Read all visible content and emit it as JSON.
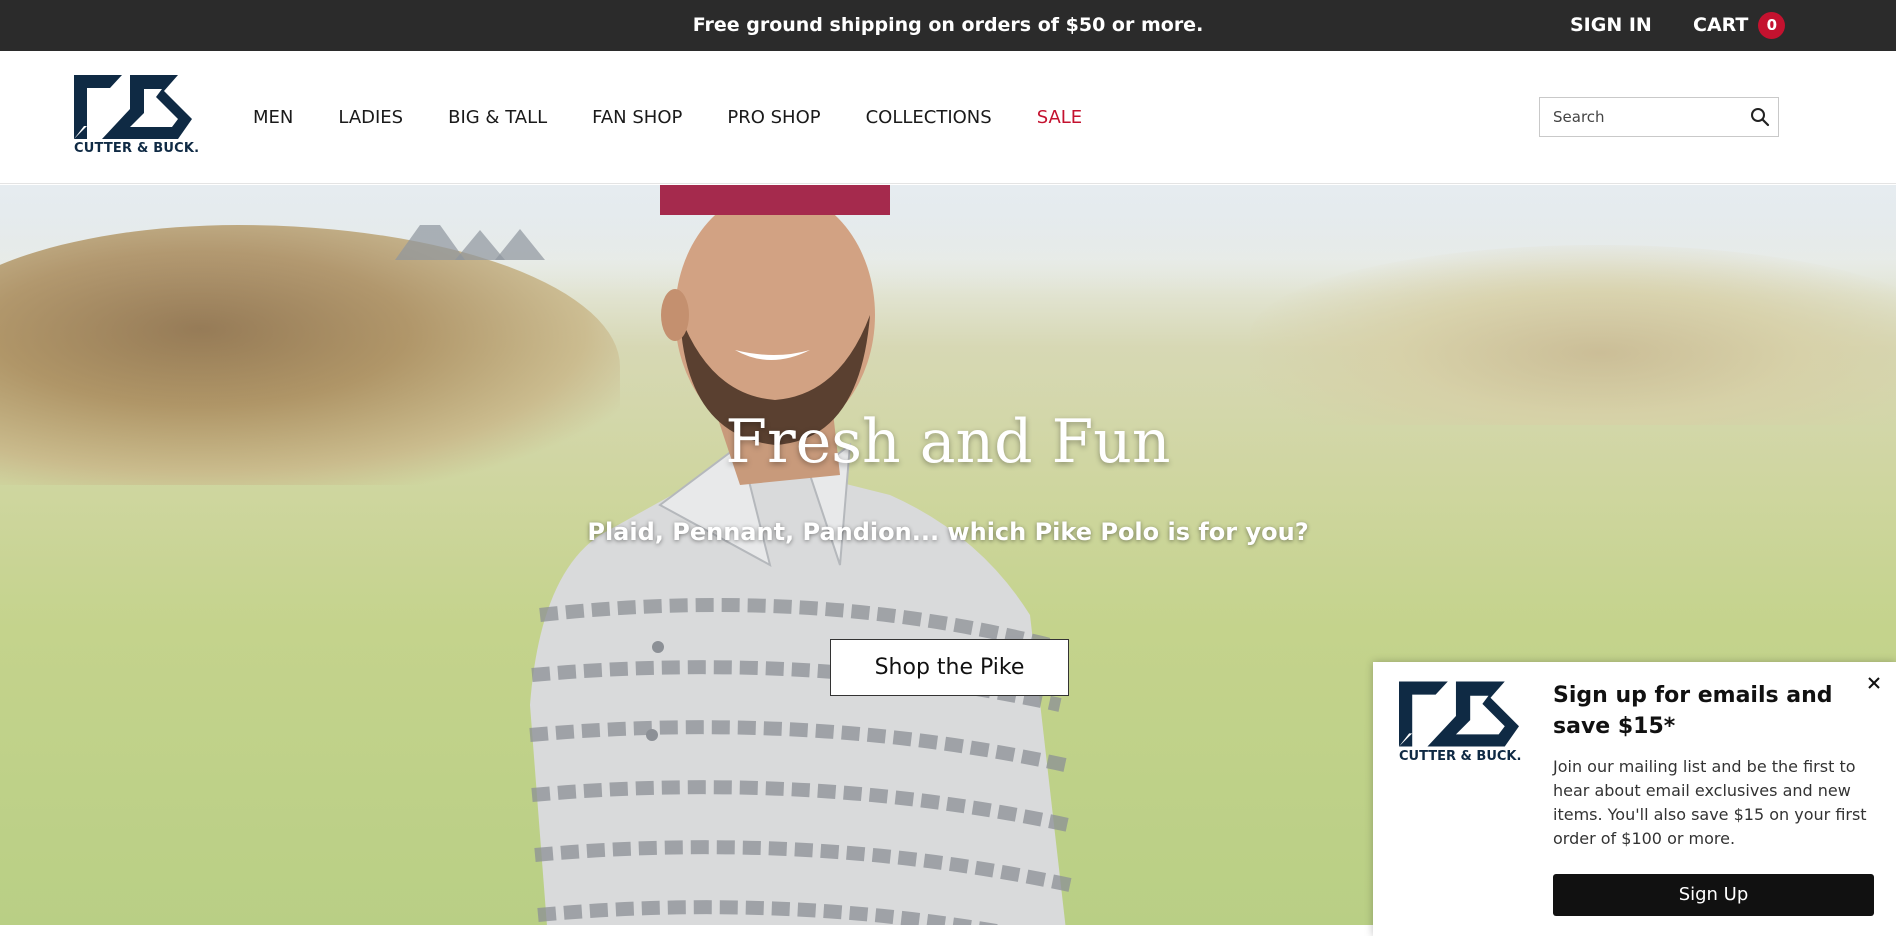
{
  "topbar": {
    "promo": "Free ground shipping on orders of $50 or more.",
    "sign_in": "SIGN IN",
    "cart_label": "CART",
    "cart_count": "0"
  },
  "header": {
    "logo_text": "CUTTER & BUCK.",
    "nav": [
      {
        "label": "MEN"
      },
      {
        "label": "LADIES"
      },
      {
        "label": "BIG & TALL"
      },
      {
        "label": "FAN SHOP"
      },
      {
        "label": "PRO SHOP"
      },
      {
        "label": "COLLECTIONS"
      },
      {
        "label": "SALE"
      }
    ],
    "search": {
      "placeholder": "Search",
      "icon": "search-icon"
    }
  },
  "hero": {
    "title": "Fresh and Fun",
    "subtitle": "Plaid, Pennant, Pandion... which Pike Polo is for you?",
    "cta": "Shop the Pike"
  },
  "popup": {
    "logo_text": "CUTTER & BUCK.",
    "title": "Sign up for emails and save $15*",
    "body": "Join our mailing list and be the first to hear about email exclusives and new items. You'll also save $15 on your first order of $100 or more.",
    "button": "Sign Up",
    "close_icon": "close-icon"
  },
  "colors": {
    "topbar_bg": "#2b2b2b",
    "brand_navy": "#0f2a44",
    "sale_red": "#c4122f",
    "button_dark": "#111111"
  }
}
